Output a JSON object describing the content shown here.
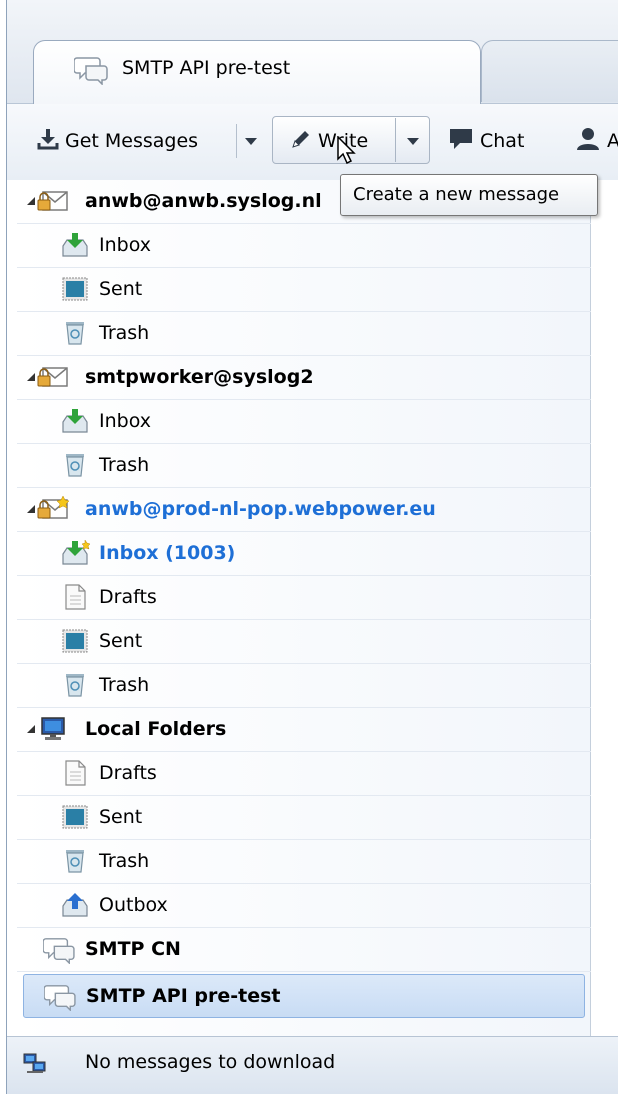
{
  "tabs": [
    {
      "label": "SMTP API pre-test",
      "icon": "chat-bubbles-icon",
      "active": true
    }
  ],
  "toolbar": {
    "get_messages": "Get Messages",
    "write": "Write",
    "chat": "Chat",
    "address_book_partial": "A"
  },
  "tooltip": {
    "text": "Create a new message"
  },
  "folders": [
    {
      "label": "anwb@anwb.syslog.nl",
      "type": "account",
      "icon": "mail-account-icon"
    },
    {
      "label": "Inbox",
      "type": "folder",
      "icon": "inbox-icon"
    },
    {
      "label": "Sent",
      "type": "folder",
      "icon": "sent-icon"
    },
    {
      "label": "Trash",
      "type": "folder",
      "icon": "trash-icon"
    },
    {
      "label": "smtpworker@syslog2",
      "type": "account",
      "icon": "mail-account-icon"
    },
    {
      "label": "Inbox",
      "type": "folder",
      "icon": "inbox-icon"
    },
    {
      "label": "Trash",
      "type": "folder",
      "icon": "trash-icon"
    },
    {
      "label": "anwb@prod-nl-pop.webpower.eu",
      "type": "account-new",
      "icon": "mail-account-new-icon"
    },
    {
      "label": "Inbox (1003)",
      "type": "folder-new",
      "icon": "inbox-new-icon"
    },
    {
      "label": "Drafts",
      "type": "folder",
      "icon": "drafts-icon"
    },
    {
      "label": "Sent",
      "type": "folder",
      "icon": "sent-icon"
    },
    {
      "label": "Trash",
      "type": "folder",
      "icon": "trash-icon"
    },
    {
      "label": "Local Folders",
      "type": "account",
      "icon": "local-folders-icon"
    },
    {
      "label": "Drafts",
      "type": "folder",
      "icon": "drafts-icon"
    },
    {
      "label": "Sent",
      "type": "folder",
      "icon": "sent-icon"
    },
    {
      "label": "Trash",
      "type": "folder",
      "icon": "trash-icon"
    },
    {
      "label": "Outbox",
      "type": "folder",
      "icon": "outbox-icon"
    },
    {
      "label": "SMTP CN",
      "type": "chat",
      "icon": "chat-bubbles-icon"
    },
    {
      "label": "SMTP API pre-test",
      "type": "chat-selected",
      "icon": "chat-bubbles-icon"
    }
  ],
  "status": {
    "text": "No messages to download",
    "icon": "network-online-icon"
  },
  "colors": {
    "new_mail": "#1e6fd6",
    "selection": "#c8dcf4"
  }
}
